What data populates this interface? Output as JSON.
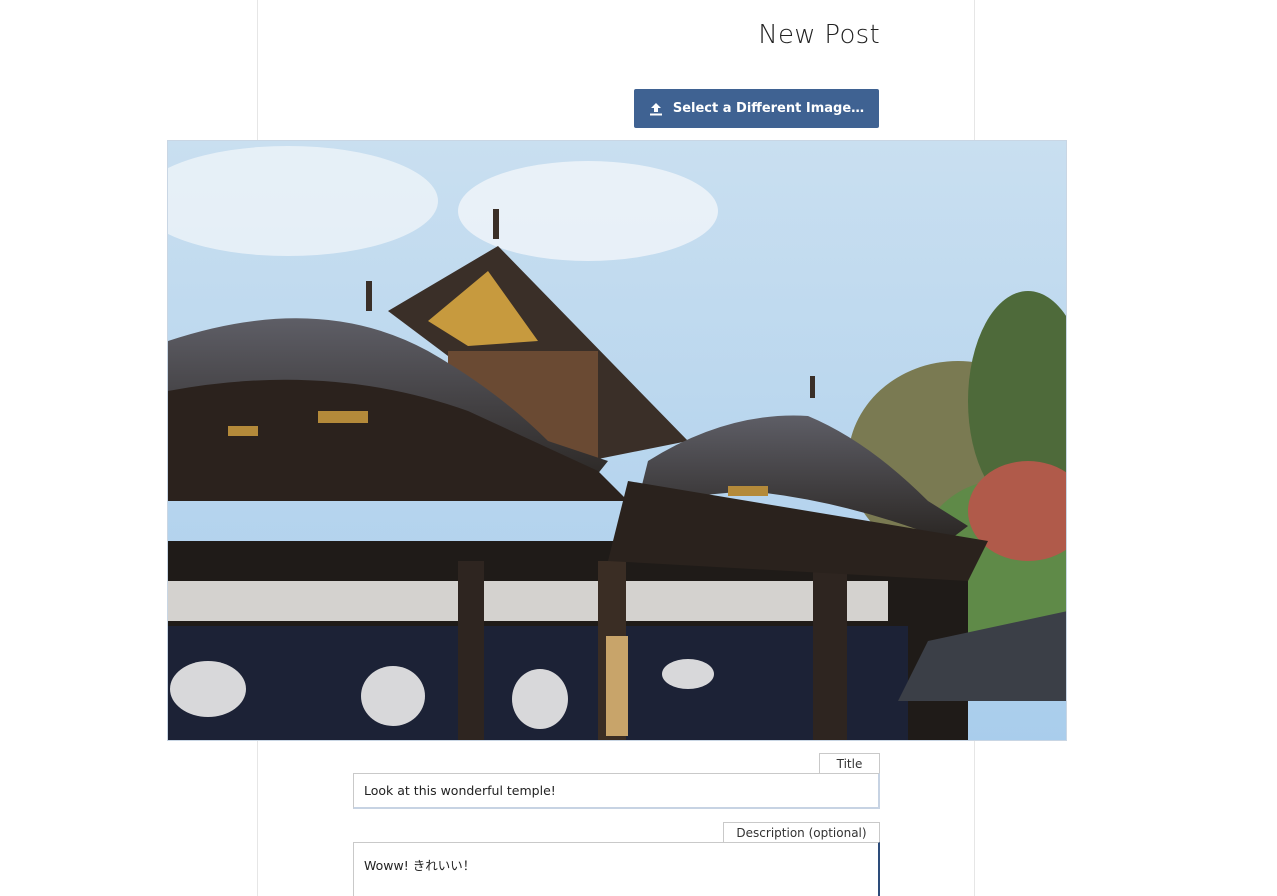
{
  "header": {
    "title": "New Post"
  },
  "upload": {
    "button_label": "Select a Different Image…",
    "icon": "upload-icon"
  },
  "form": {
    "title_label": "Title",
    "title_value": "Look at this wonderful temple!",
    "description_label": "Description (optional)",
    "description_value": "Woww! きれいい！"
  },
  "colors": {
    "accent": "#3f6292",
    "input_focus_border": "#2d4c7a"
  }
}
